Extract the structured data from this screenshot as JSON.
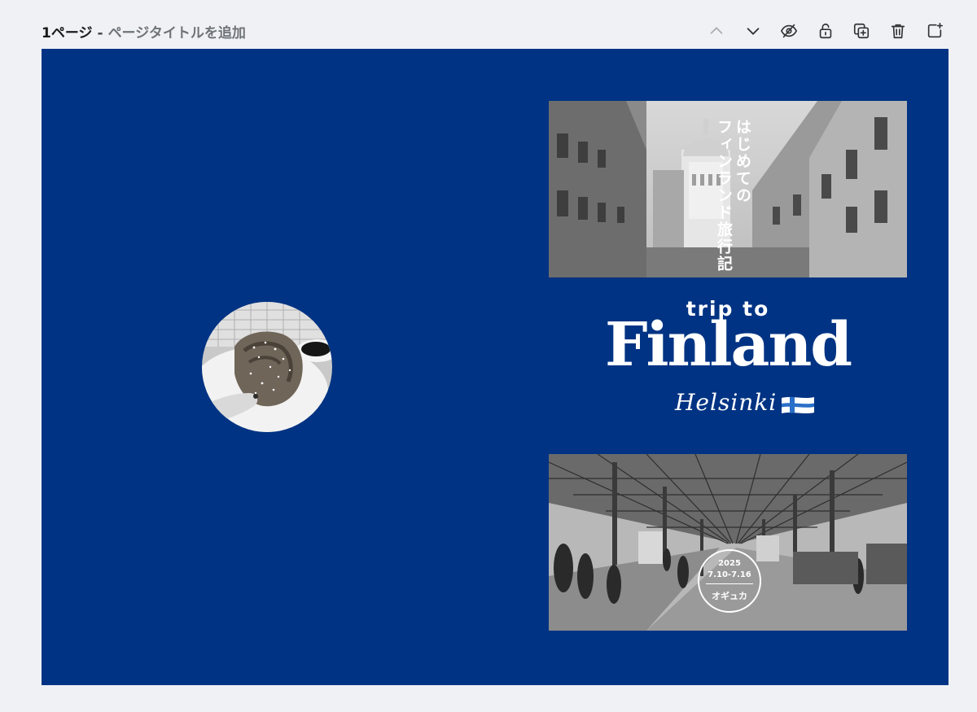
{
  "header": {
    "page_number": "1ページ",
    "separator": "-",
    "title_placeholder": "ページタイトルを追加"
  },
  "toolbar": {
    "items": [
      {
        "icon": "chevron-up-icon",
        "enabled": false
      },
      {
        "icon": "chevron-down-icon",
        "enabled": true
      },
      {
        "icon": "hide-eye-icon",
        "enabled": true
      },
      {
        "icon": "unlock-icon",
        "enabled": true
      },
      {
        "icon": "duplicate-icon",
        "enabled": true
      },
      {
        "icon": "trash-icon",
        "enabled": true
      },
      {
        "icon": "add-page-icon",
        "enabled": true
      }
    ]
  },
  "design": {
    "background_color": "#003383",
    "vertical_title_line1": "はじめての",
    "vertical_title_line2": "フィンランド旅行記",
    "trip_to": "trip to",
    "finland": "Finland",
    "helsinki": "Helsinki",
    "stamp": {
      "year": "2025",
      "dates": "7.10-7.16",
      "name": "オギュカ"
    }
  }
}
